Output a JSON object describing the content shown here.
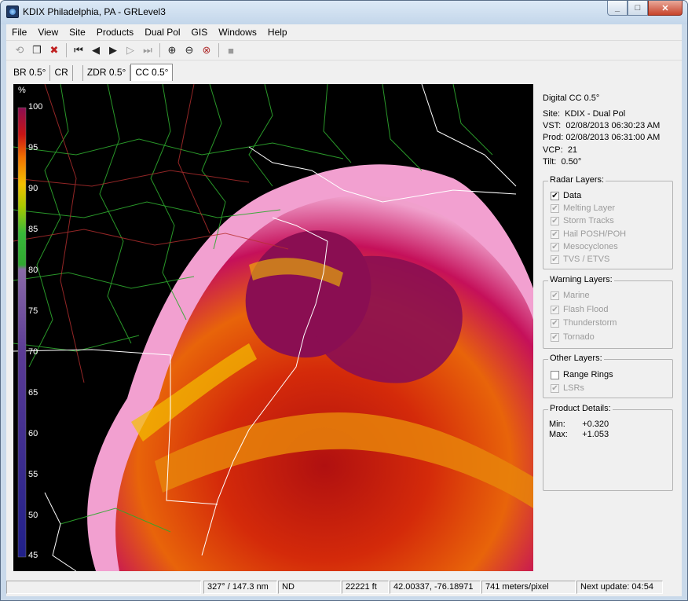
{
  "window": {
    "title": "KDIX Philadelphia, PA - GRLevel3",
    "minimize": "_",
    "maximize": "□",
    "close": "✕"
  },
  "menu": [
    "File",
    "View",
    "Site",
    "Products",
    "Dual Pol",
    "GIS",
    "Windows",
    "Help"
  ],
  "toolbar": {
    "buttons": [
      "back",
      "copy",
      "delete",
      "first-frame",
      "prev-frame",
      "play",
      "next-frame",
      "last-frame",
      "zoom-in",
      "zoom-out",
      "zoom-reset",
      "stop"
    ]
  },
  "tabs": [
    "BR 0.5°",
    "CR",
    "ZDR 0.5°",
    "CC 0.5°"
  ],
  "active_tab": "CC 0.5°",
  "legend": {
    "unit": "%",
    "ticks": [
      "100",
      "95",
      "90",
      "85",
      "80",
      "75",
      "70",
      "65",
      "60",
      "55",
      "50",
      "45"
    ]
  },
  "product": {
    "name": "Digital CC 0.5°",
    "site_label": "Site:",
    "site": "KDIX - Dual Pol",
    "vst_label": "VST:",
    "vst": "02/08/2013  06:30:23 AM",
    "prod_label": "Prod:",
    "prod": "02/08/2013  06:31:00 AM",
    "vcp_label": "VCP:",
    "vcp": "21",
    "tilt_label": "Tilt:",
    "tilt": "0.50°"
  },
  "radar_layers": {
    "title": "Radar Layers:",
    "items": [
      {
        "label": "Data",
        "checked": true,
        "enabled": true
      },
      {
        "label": "Melting Layer",
        "checked": true,
        "enabled": false
      },
      {
        "label": "Storm Tracks",
        "checked": true,
        "enabled": false
      },
      {
        "label": "Hail POSH/POH",
        "checked": true,
        "enabled": false
      },
      {
        "label": "Mesocyclones",
        "checked": true,
        "enabled": false
      },
      {
        "label": "TVS / ETVS",
        "checked": true,
        "enabled": false
      }
    ]
  },
  "warning_layers": {
    "title": "Warning Layers:",
    "items": [
      {
        "label": "Marine",
        "checked": true,
        "enabled": false
      },
      {
        "label": "Flash Flood",
        "checked": true,
        "enabled": false
      },
      {
        "label": "Thunderstorm",
        "checked": true,
        "enabled": false
      },
      {
        "label": "Tornado",
        "checked": true,
        "enabled": false
      }
    ]
  },
  "other_layers": {
    "title": "Other Layers:",
    "items": [
      {
        "label": "Range Rings",
        "checked": false,
        "enabled": true
      },
      {
        "label": "LSRs",
        "checked": true,
        "enabled": false
      }
    ]
  },
  "product_details": {
    "title": "Product Details:",
    "min_label": "Min:",
    "min": "+0.320",
    "max_label": "Max:",
    "max": "+1.053"
  },
  "status": {
    "bearing_range": "327° / 147.3 nm",
    "value": "ND",
    "height": "22221 ft",
    "latlon": "42.00337, -76.18971",
    "resolution": "741 meters/pixel",
    "next_update": "Next update: 04:54"
  },
  "colors": {
    "cc_low": "#20208a",
    "cc_mid": "#7d4a9e",
    "cc_green": "#38b83a",
    "cc_yellow": "#f3c000",
    "cc_orange": "#f07000",
    "cc_red": "#c41212",
    "cc_maroon": "#8a0e52",
    "cc_pink": "#f2a0d0"
  }
}
